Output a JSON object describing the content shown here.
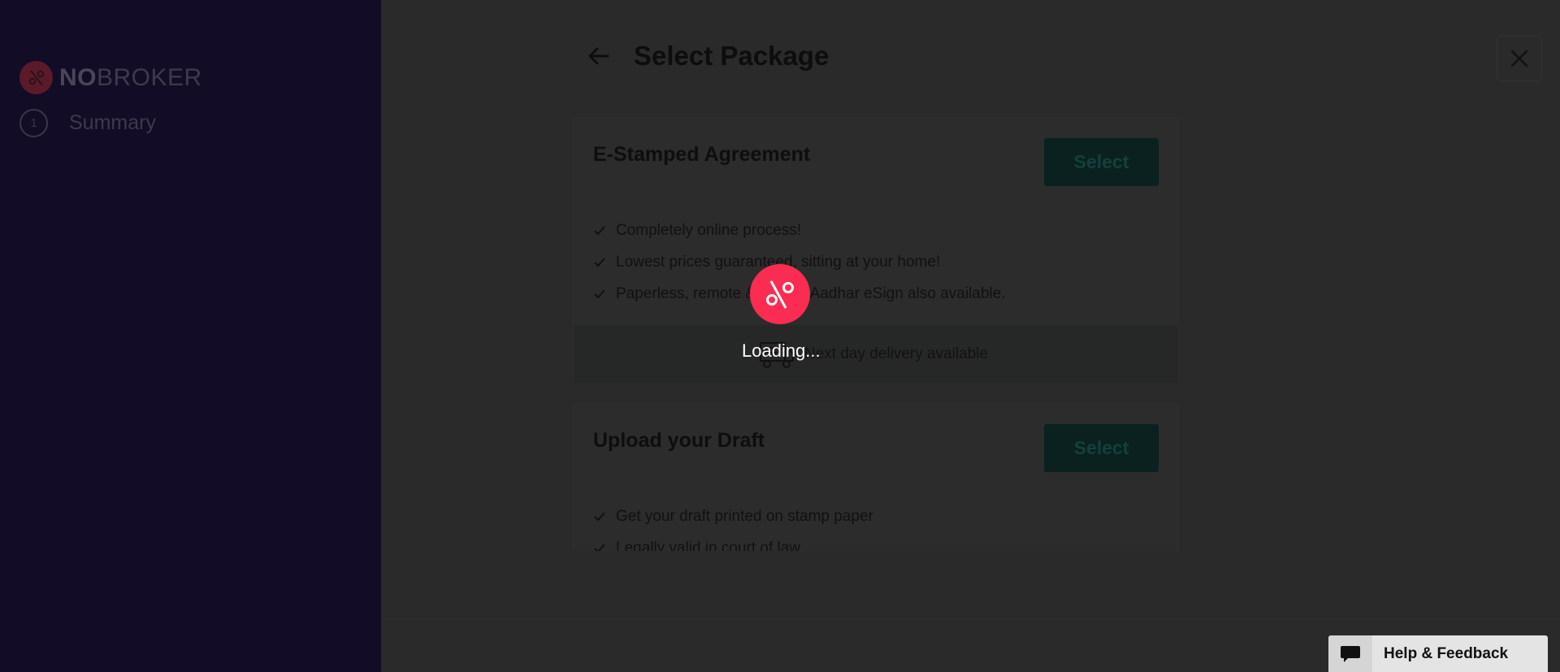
{
  "brand": {
    "logo_prefix": "NO",
    "logo_suffix": "BROKER"
  },
  "sidebar": {
    "steps": [
      {
        "number": "1",
        "label": "Summary"
      }
    ]
  },
  "header": {
    "title": "Select Package"
  },
  "packages": [
    {
      "title": "E-Stamped Agreement",
      "select_label": "Select",
      "features": [
        "Completely online process!",
        "Lowest prices guaranteed, sitting at your home!",
        "Paperless, remote & secure Aadhar eSign also available."
      ],
      "delivery": "Next day delivery available"
    },
    {
      "title": "Upload your Draft",
      "select_label": "Select",
      "features": [
        "Get your draft printed on stamp paper",
        "Legally valid in court of law"
      ]
    }
  ],
  "loader": {
    "text": "Loading..."
  },
  "help": {
    "label": "Help & Feedback"
  },
  "colors": {
    "loader_accent": "#fb2c51",
    "sidebar_bg": "#120c26",
    "select_btn": "#0a2120"
  }
}
